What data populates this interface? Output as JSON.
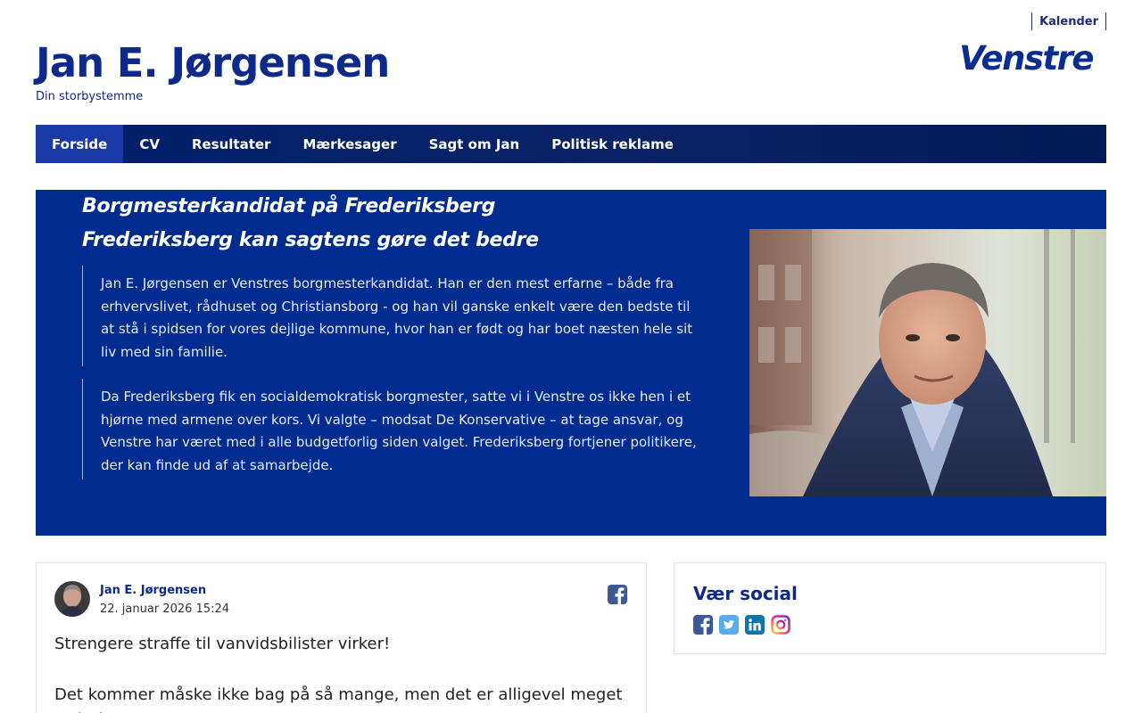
{
  "topbar": {
    "calendar_label": "Kalender"
  },
  "logo": {
    "text": "Venstre"
  },
  "site": {
    "title": "Jan E. Jørgensen",
    "subtitle": "Din storbystemme"
  },
  "nav": {
    "items": [
      {
        "label": "Forside",
        "active": true
      },
      {
        "label": "CV"
      },
      {
        "label": "Resultater"
      },
      {
        "label": "Mærkesager"
      },
      {
        "label": "Sagt om Jan"
      },
      {
        "label": "Politisk reklame"
      }
    ]
  },
  "hero": {
    "heading1": "Borgmesterkandidat på Frederiksberg",
    "heading2": "Frederiksberg kan sagtens gøre det bedre",
    "paragraph1": "Jan E. Jørgensen er Venstres borgmesterkandidat. Han er den mest erfarne – både fra erhvervslivet, rådhuset og Christiansborg - og han vil ganske enkelt være den bedste til at stå i spidsen for vores dejlige kommune, hvor han er født og har boet næsten hele sit liv med sin familie.",
    "paragraph2": "Da Frederiksberg fik en socialdemokratisk borgmester, satte vi i Venstre os ikke hen i et hjørne med armene over kors. Vi valgte – modsat De Konservative – at tage ansvar, og Venstre har været med i alle budgetforlig siden valget. Frederiksberg fortjener politikere, der kan finde ud af at samarbejde."
  },
  "post": {
    "author": "Jan E. Jørgensen",
    "date": "22. januar 2026 15:24",
    "text1": "Strengere straffe til vanvidsbilister virker!",
    "text2": "Det kommer måske ikke bag på så mange, men det er alligevel meget rart at se"
  },
  "social": {
    "title": "Vær social",
    "icons": [
      "facebook-icon",
      "twitter-icon",
      "linkedin-icon",
      "instagram-icon"
    ]
  },
  "colors": {
    "brand": "#002b8f",
    "nav": "#001f6b",
    "nav_active": "#1a3aa8"
  }
}
